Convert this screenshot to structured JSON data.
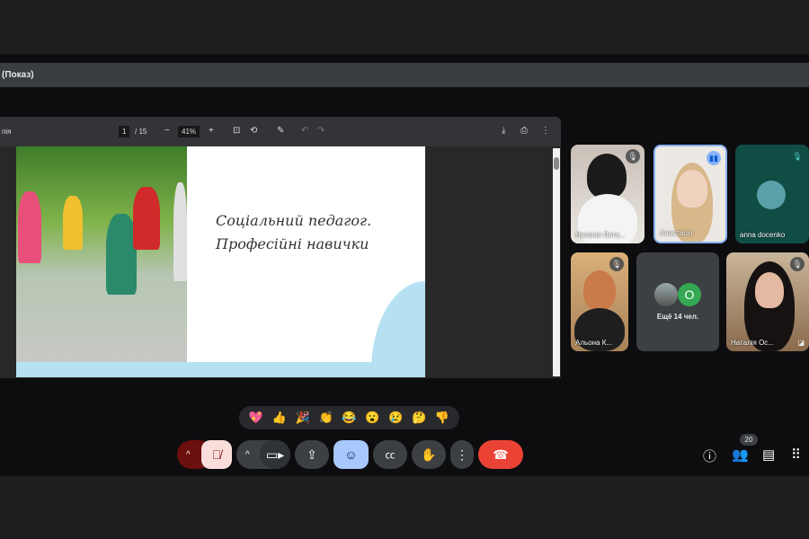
{
  "window": {
    "title": "(Показ)"
  },
  "pdf": {
    "filename": "пія",
    "page": "1",
    "pages": "/ 15",
    "zoom": "41%",
    "zoom_out": "−",
    "zoom_in": "+",
    "slide_line1": "Соціальний педагог.",
    "slide_line2": "Професійні навички"
  },
  "participants": [
    {
      "name": "Наталія Лита...",
      "muted": true
    },
    {
      "name": "Анастасія",
      "speaking": true
    },
    {
      "name": "anna docenko",
      "muted": true
    },
    {
      "name": "Альона К...",
      "muted": true
    },
    {
      "name": "Наталія Ос...",
      "muted": true
    }
  ],
  "more": {
    "label": "Ещё 14 чел.",
    "avatar_letter": "O"
  },
  "reactions": [
    "💖",
    "👍",
    "🎉",
    "👏",
    "😂",
    "😮",
    "😢",
    "🤔",
    "👎"
  ],
  "controls": {
    "participants_count": "20"
  },
  "colors": {
    "accent": "#8ab4f8",
    "end_call": "#ea4335",
    "mic_off": "#f9dedc"
  }
}
